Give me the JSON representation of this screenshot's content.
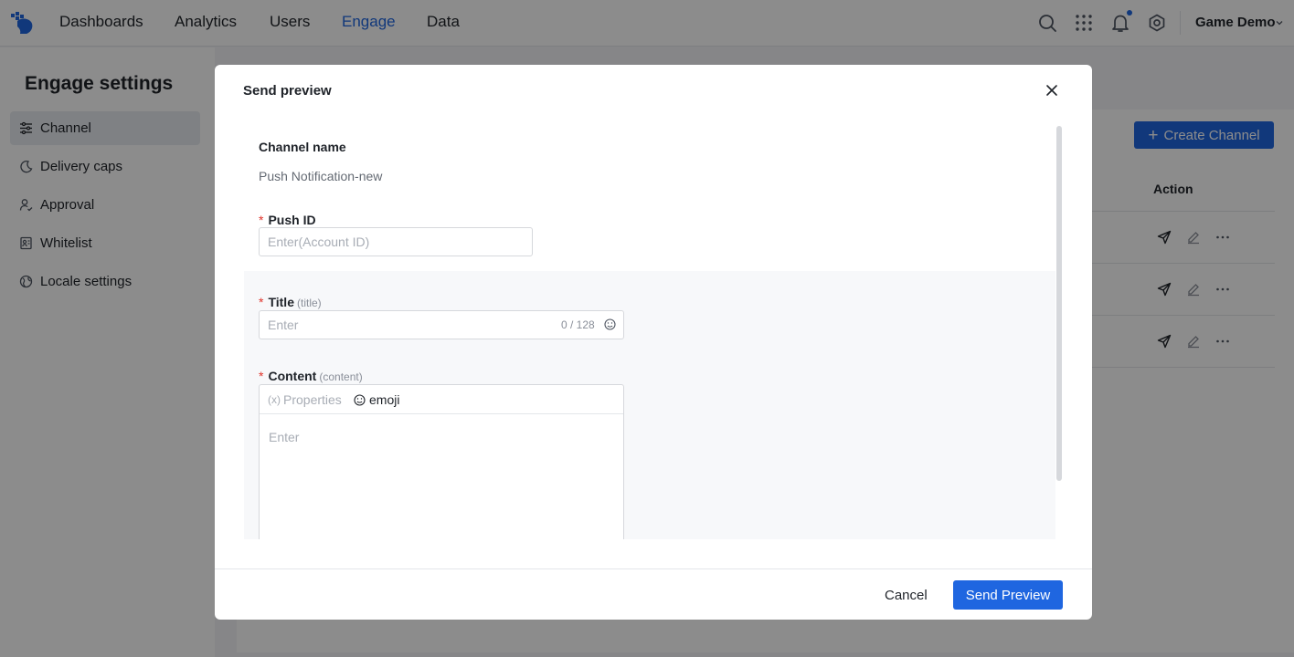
{
  "nav": {
    "items": [
      "Dashboards",
      "Analytics",
      "Users",
      "Engage",
      "Data"
    ],
    "active": "Engage",
    "project": "Game Demo"
  },
  "sidebar": {
    "title": "Engage settings",
    "items": [
      {
        "label": "Channel",
        "icon": "sliders-icon",
        "active": true
      },
      {
        "label": "Delivery caps",
        "icon": "moon-icon",
        "active": false
      },
      {
        "label": "Approval",
        "icon": "user-check-icon",
        "active": false
      },
      {
        "label": "Whitelist",
        "icon": "contact-list-icon",
        "active": false
      },
      {
        "label": "Locale settings",
        "icon": "globe-icon",
        "active": false
      }
    ]
  },
  "main": {
    "create_label": "Create Channel",
    "action_header": "Action"
  },
  "modal": {
    "title": "Send preview",
    "channel_name_label": "Channel name",
    "channel_name_value": "Push Notification-new",
    "push_id_label": "Push ID",
    "push_id_placeholder": "Enter(Account ID)",
    "title_label": "Title",
    "title_hint": "(title)",
    "title_placeholder": "Enter",
    "title_counter": "0 / 128",
    "content_label": "Content",
    "content_hint": "(content)",
    "properties_label": "Properties",
    "properties_glyph": "(x)",
    "emoji_label": "emoji",
    "content_placeholder": "Enter",
    "cancel_label": "Cancel",
    "send_label": "Send Preview"
  },
  "colors": {
    "accent": "#1f66e0",
    "required": "#e0342b"
  }
}
